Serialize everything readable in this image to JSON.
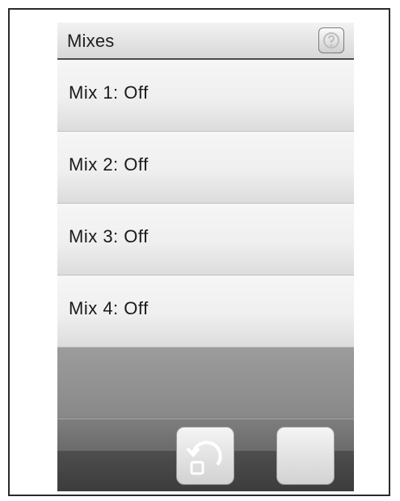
{
  "header": {
    "title": "Mixes",
    "help_icon": "help-icon"
  },
  "mixes": [
    {
      "label": "Mix 1: Off"
    },
    {
      "label": "Mix 2: Off"
    },
    {
      "label": "Mix 3: Off"
    },
    {
      "label": "Mix 4: Off"
    }
  ],
  "toolbar": {
    "buttons": [
      {
        "icon": "undo-icon"
      },
      {
        "icon": "blank-button"
      }
    ]
  }
}
